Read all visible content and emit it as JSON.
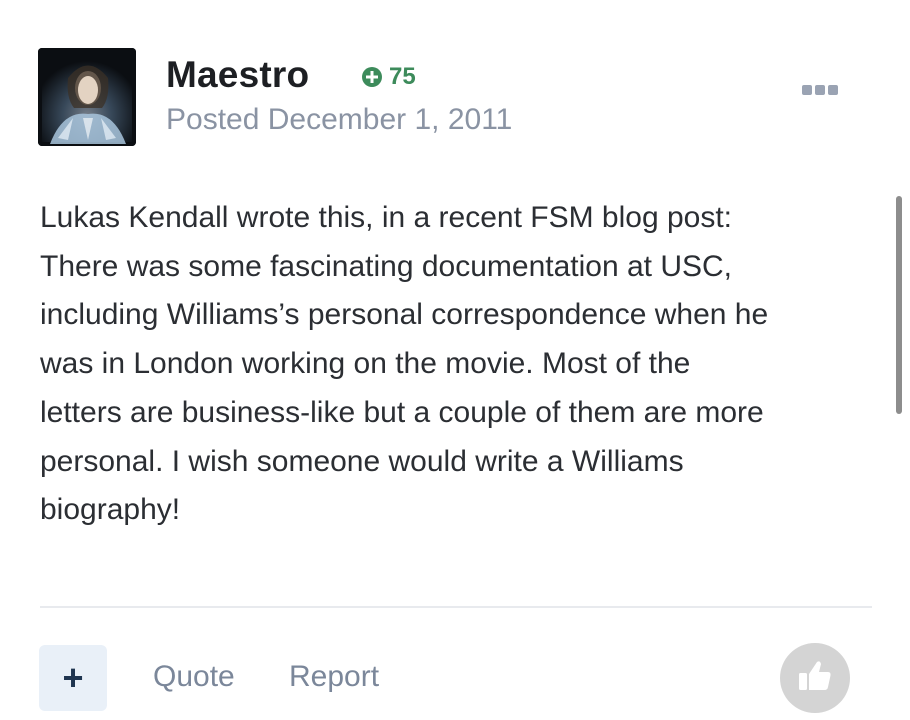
{
  "post": {
    "author": "Maestro",
    "reputation": "75",
    "posted_prefix": "Posted",
    "posted_date": "December 1, 2011",
    "body_lines": [
      "Lukas Kendall wrote this, in a recent FSM blog post:",
      "There was some fascinating documentation at USC,",
      "including Williams’s personal correspondence when he",
      "was in London working on the movie. Most of the",
      "letters are business-like but a couple of them are more",
      "personal. I wish someone would write a Williams",
      "biography!"
    ]
  },
  "actions": {
    "plus_label": "+",
    "quote_label": "Quote",
    "report_label": "Report"
  },
  "icons": {
    "reputation": "plus-circle-icon",
    "menu": "ellipsis-icon",
    "like": "thumbs-up-icon"
  },
  "colors": {
    "reputation": "#3d8b5b",
    "muted": "#8a93a3",
    "link": "#7b879a",
    "plus_bg": "#e9f0f8",
    "like_bg": "#d4d4d4"
  }
}
